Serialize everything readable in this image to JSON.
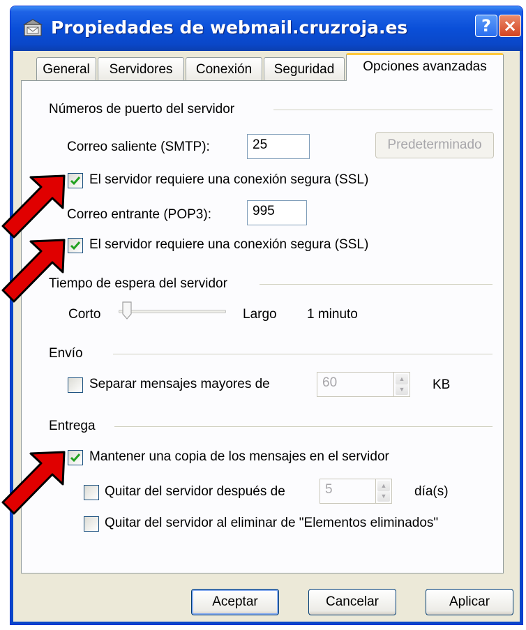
{
  "window": {
    "title": "Propiedades de webmail.cruzroja.es",
    "help_label": "?",
    "close_label": "×"
  },
  "tabs": [
    {
      "label": "General"
    },
    {
      "label": "Servidores"
    },
    {
      "label": "Conexión"
    },
    {
      "label": "Seguridad"
    },
    {
      "label": "Opciones avanzadas",
      "active": true
    }
  ],
  "ports": {
    "heading": "Números de puerto del servidor",
    "smtp_label": "Correo saliente (SMTP):",
    "smtp_value": "25",
    "default_button": "Predeterminado",
    "smtp_ssl_label": "El servidor requiere una conexión segura (SSL)",
    "smtp_ssl_checked": true,
    "pop3_label": "Correo entrante (POP3):",
    "pop3_value": "995",
    "pop3_ssl_label": "El servidor requiere una conexión segura (SSL)",
    "pop3_ssl_checked": true
  },
  "timeout": {
    "heading": "Tiempo de espera del servidor",
    "short_label": "Corto",
    "long_label": "Largo",
    "value": "1 minuto",
    "slider_level": 0.1
  },
  "sending": {
    "heading": "Envío",
    "split_label": "Separar mensajes mayores de",
    "split_checked": false,
    "split_value": "60",
    "unit": "KB"
  },
  "delivery": {
    "heading": "Entrega",
    "keep_copy_label": "Mantener una copia de los mensajes en el servidor",
    "keep_copy_checked": true,
    "remove_after_label": "Quitar del servidor después de",
    "remove_after_checked": false,
    "remove_after_value": "5",
    "remove_after_unit": "día(s)",
    "remove_deleted_label": "Quitar del servidor al eliminar de \"Elementos eliminados\"",
    "remove_deleted_checked": false
  },
  "buttons": {
    "ok": "Aceptar",
    "cancel": "Cancelar",
    "apply": "Aplicar"
  },
  "colors": {
    "titlebar": "#0a4fd8",
    "check": "#21a121",
    "arrow": "#e00000",
    "active_tab_accent": "#ffc83c"
  }
}
